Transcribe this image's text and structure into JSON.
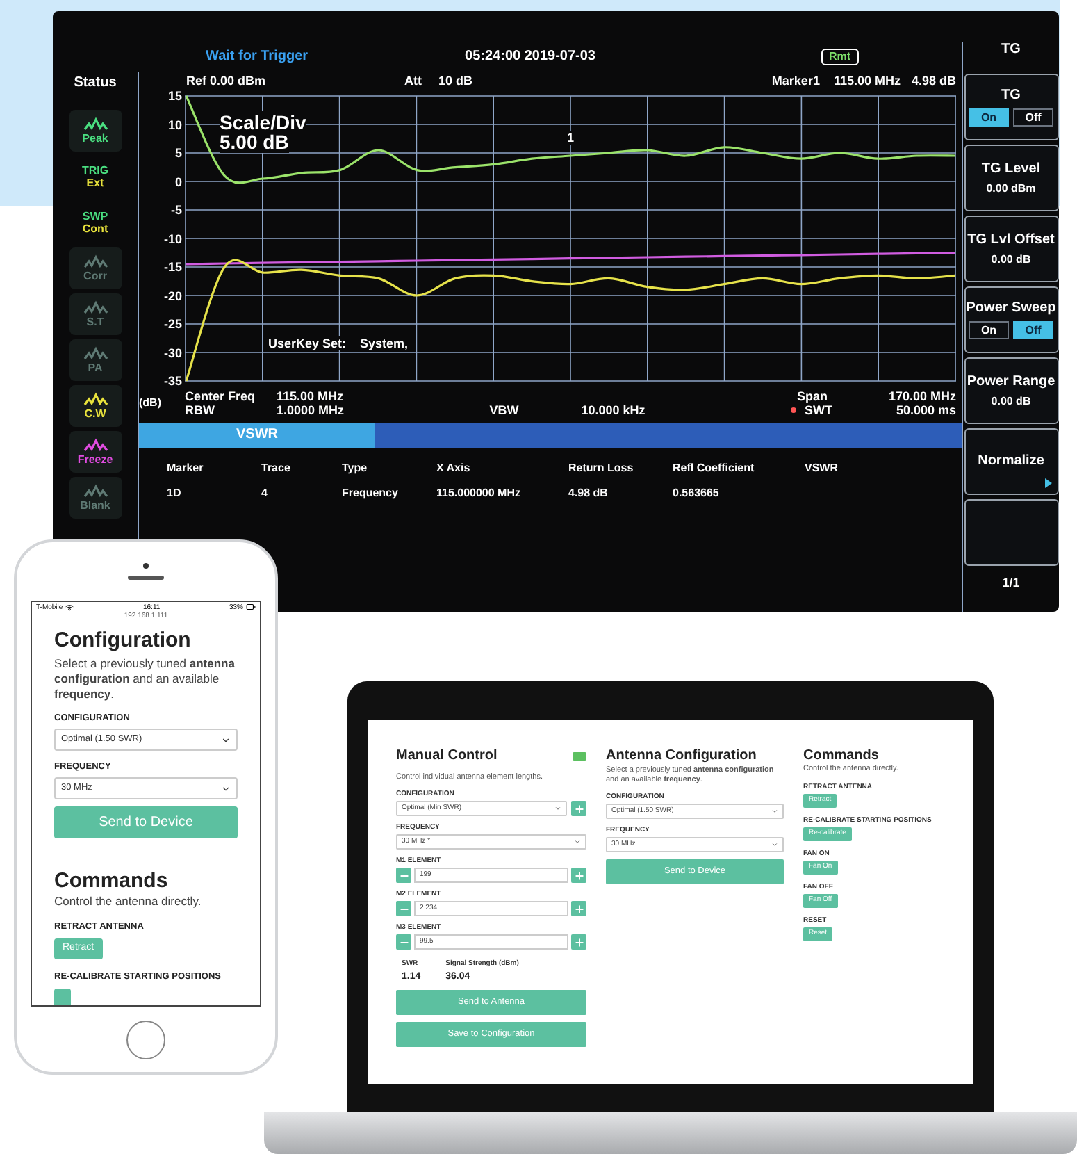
{
  "analyzer": {
    "trigger_status": "Wait for Trigger",
    "datetime": "05:24:00 2019-07-03",
    "remote_badge": "Rmt",
    "status_title": "Status",
    "status_items": [
      {
        "kind": "icon",
        "label": "Peak",
        "color": "#4ade80"
      },
      {
        "kind": "text",
        "top": "TRIG",
        "label": "Ext"
      },
      {
        "kind": "text",
        "top": "SWP",
        "label": "Cont"
      },
      {
        "kind": "icon",
        "label": "Corr",
        "color": "#5f7a74"
      },
      {
        "kind": "icon",
        "label": "S.T",
        "color": "#5f7a74"
      },
      {
        "kind": "icon",
        "label": "PA",
        "color": "#5f7a74"
      },
      {
        "kind": "icon",
        "label": "C.W",
        "color": "#e8e23c"
      },
      {
        "kind": "icon",
        "label": "Freeze",
        "color": "#e04ce0"
      },
      {
        "kind": "icon",
        "label": "Blank",
        "color": "#5f7a74"
      }
    ],
    "ref": "Ref 0.00 dBm",
    "att_label": "Att",
    "att_value": "10 dB",
    "marker_label": "Marker1",
    "marker_freq": "115.00 MHz",
    "marker_value": "4.98 dB",
    "chart_data": {
      "type": "line",
      "grid": true,
      "ylim": [
        -35,
        15
      ],
      "yticks": [
        15,
        10,
        5,
        0,
        -5,
        -10,
        -15,
        -20,
        -25,
        -30,
        -35
      ],
      "series": [
        {
          "color": "#9be36a",
          "values": [
            15,
            1,
            0.5,
            1.5,
            2,
            5.5,
            2,
            2.5,
            3,
            4,
            4.5,
            5,
            5.5,
            4.5,
            6,
            5,
            4,
            5,
            4,
            4.5,
            4.5
          ]
        },
        {
          "color": "#d05ce0",
          "values": [
            -14.5,
            -14.4,
            -14.3,
            -14.2,
            -14.1,
            -14,
            -13.9,
            -13.8,
            -13.7,
            -13.6,
            -13.5,
            -13.4,
            -13.3,
            -13.2,
            -13.1,
            -13,
            -12.9,
            -12.8,
            -12.7,
            -12.6,
            -12.5
          ]
        },
        {
          "color": "#e6e24a",
          "values": [
            -35,
            -15,
            -16,
            -15.5,
            -16.5,
            -17,
            -20,
            -17,
            -16.5,
            -17.5,
            -18,
            -17,
            -18.5,
            -19,
            -18,
            -17,
            -18,
            -17,
            -16.5,
            -17,
            -16.5
          ]
        }
      ]
    },
    "unit": "(dB)",
    "scale_label": "Scale/Div",
    "scale_value": "5.00 dB",
    "marker_number": "1",
    "userkey_label": "UserKey Set:",
    "userkey_value": "System,",
    "footer": [
      [
        {
          "label": "Center Freq",
          "value": "115.00 MHz",
          "dot": false
        },
        {
          "label": "Span",
          "value": "170.00 MHz",
          "dot": false
        }
      ],
      [
        {
          "label": "RBW",
          "value": "1.0000 MHz",
          "dot": false
        },
        {
          "label": "VBW",
          "value": "10.000 kHz",
          "dot": false
        },
        {
          "label": "SWT",
          "value": "50.000 ms",
          "dot": true
        }
      ]
    ],
    "tab": "VSWR",
    "table": {
      "columns": [
        "Marker",
        "Trace",
        "Type",
        "X Axis",
        "Return Loss",
        "Refl Coefficient",
        "VSWR"
      ],
      "rows": [
        [
          "1D",
          "4",
          "Frequency",
          "115.000000 MHz",
          "4.98 dB",
          "0.563665"
        ]
      ]
    },
    "softkeys": {
      "title": "TG",
      "items": [
        {
          "kind": "toggle",
          "label": "TG",
          "options": [
            {
              "label": "On",
              "selected": true
            },
            {
              "label": "Off",
              "selected": false
            }
          ]
        },
        {
          "kind": "value",
          "label": "TG Level",
          "value": "0.00 dBm"
        },
        {
          "kind": "value",
          "label": "TG Lvl Offset",
          "value": "0.00 dB"
        },
        {
          "kind": "toggle",
          "label": "Power Sweep",
          "options": [
            {
              "label": "On",
              "selected": false
            },
            {
              "label": "Off",
              "selected": true
            }
          ]
        },
        {
          "kind": "value",
          "label": "Power Range",
          "value": "0.00 dB"
        },
        {
          "kind": "submenu",
          "label": "Normalize"
        },
        {
          "kind": "empty"
        }
      ],
      "page": "1/1"
    }
  },
  "phone": {
    "carrier": "T-Mobile",
    "time": "16:11",
    "battery": "33%",
    "url": "192.168.1.111",
    "config_title": "Configuration",
    "config_desc": "Select a previously tuned **antenna configuration** and an available **frequency**.",
    "fields": [
      {
        "label": "CONFIGURATION",
        "value": "Optimal (1.50 SWR)"
      },
      {
        "label": "FREQUENCY",
        "value": "30 MHz"
      }
    ],
    "send_button": "Send to Device",
    "commands_title": "Commands",
    "commands_desc": "Control the antenna directly.",
    "commands": [
      {
        "label": "RETRACT ANTENNA",
        "button": "Retract"
      },
      {
        "label": "RE-CALIBRATE STARTING POSITIONS"
      }
    ]
  },
  "laptop": {
    "manual": {
      "title": "Manual Control",
      "desc": "Control individual antenna element lengths.",
      "fields": [
        {
          "kind": "select_add",
          "label": "CONFIGURATION",
          "value": "Optimal (Min SWR)"
        },
        {
          "kind": "select",
          "label": "FREQUENCY",
          "value": "30 MHz *"
        },
        {
          "kind": "stepper",
          "label": "M1 ELEMENT",
          "value": "199"
        },
        {
          "kind": "stepper",
          "label": "M2 ELEMENT",
          "value": "2.234"
        },
        {
          "kind": "stepper",
          "label": "M3 ELEMENT",
          "value": "99.5"
        }
      ],
      "readings": [
        {
          "label": "SWR",
          "value": "1.14"
        },
        {
          "label": "Signal Strength (dBm)",
          "value": "36.04"
        }
      ],
      "buttons": [
        "Send to Antenna",
        "Save to Configuration"
      ]
    },
    "config": {
      "title": "Antenna Configuration",
      "desc": "Select a previously tuned **antenna configuration** and an available **frequency**.",
      "fields": [
        {
          "kind": "select",
          "label": "CONFIGURATION",
          "value": "Optimal (1.50 SWR)"
        },
        {
          "kind": "select",
          "label": "FREQUENCY",
          "value": "30 MHz"
        }
      ],
      "button": "Send to Device"
    },
    "commands": {
      "title": "Commands",
      "desc": "Control the antenna directly.",
      "items": [
        {
          "label": "RETRACT ANTENNA",
          "button": "Retract"
        },
        {
          "label": "RE-CALIBRATE STARTING POSITIONS",
          "button": "Re-calibrate"
        },
        {
          "label": "FAN ON",
          "button": "Fan On"
        },
        {
          "label": "FAN OFF",
          "button": "Fan Off"
        },
        {
          "label": "RESET",
          "button": "Reset"
        }
      ]
    }
  }
}
